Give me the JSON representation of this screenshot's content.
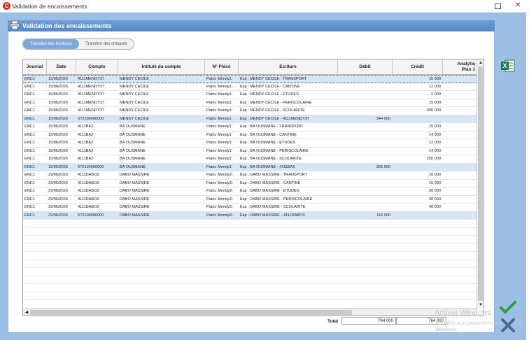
{
  "window": {
    "title": "Validation de encaissements",
    "maximize_glyph": "",
    "close_glyph": "✕"
  },
  "panel": {
    "title": "Validation des encaissements",
    "icon": "printer-icon"
  },
  "tabs": [
    {
      "label": "Transfert des écritures",
      "active": true
    },
    {
      "label": "Transfert des chèques",
      "active": false
    }
  ],
  "table": {
    "columns": [
      "Journal",
      "Date",
      "Compte",
      "Intitulé du compte",
      "N° Pièce",
      "Ecriture",
      "Débit",
      "Crédit",
      "Analytiq",
      "Plan 1"
    ],
    "rows": [
      {
        "journal": "ENC1",
        "date": "15/06/2026",
        "compte": "4111MENDY37",
        "intitule": "MENDY CECILE",
        "piece": "Patric Mendy1:",
        "ecriture": "Esp : MENDY CECILE - TRANSPORT",
        "debit": "",
        "credit": "15 000",
        "style": "sel"
      },
      {
        "journal": "ENC1",
        "date": "15/06/2026",
        "compte": "4111MENDY37",
        "intitule": "MENDY CECILE",
        "piece": "Patric Mendy1:",
        "ecriture": "Esp : MENDY CECILE - CANTINE",
        "debit": "",
        "credit": "12 000",
        "style": ""
      },
      {
        "journal": "ENC1",
        "date": "15/06/2026",
        "compte": "4111MENDY37",
        "intitule": "MENDY CECILE",
        "piece": "Patric Mendy1:",
        "ecriture": "Esp : MENDY CECILE - ETUDES",
        "debit": "",
        "credit": "2 000",
        "style": ""
      },
      {
        "journal": "ENC1",
        "date": "15/06/2026",
        "compte": "4111MENDY37",
        "intitule": "MENDY CECILE",
        "piece": "Patric Mendy1:",
        "ecriture": "Esp : MENDY CECILE - PERISCOLAIRE",
        "debit": "",
        "credit": "15 000",
        "style": ""
      },
      {
        "journal": "ENC1",
        "date": "15/06/2026",
        "compte": "4111MENDY37",
        "intitule": "MENDY CECILE",
        "piece": "Patric Mendy1:",
        "ecriture": "Esp : MENDY CECILE - SCOLARITE",
        "debit": "",
        "credit": "300 000",
        "style": ""
      },
      {
        "journal": "ENC1",
        "date": "15/06/2026",
        "compte": "572100000000",
        "intitule": "MENDY CECILE",
        "piece": "Patric Mendy1:",
        "ecriture": "Esp : MENDY CECILE - 4111MENDY37",
        "debit": "344 000",
        "credit": "",
        "style": "hl"
      },
      {
        "journal": "ENC1",
        "date": "15/06/2026",
        "compte": "4111BA2",
        "intitule": "BA OUSMANE",
        "piece": "Patric Mendy1'",
        "ecriture": "Esp : BA OUSMANE - TRANSPORT",
        "debit": "",
        "credit": "15 000",
        "style": ""
      },
      {
        "journal": "ENC1",
        "date": "15/06/2026",
        "compte": "4111BA2",
        "intitule": "BA OUSMANE",
        "piece": "Patric Mendy1'",
        "ecriture": "Esp : BA OUSMANE - CANTINE",
        "debit": "",
        "credit": "14 000",
        "style": ""
      },
      {
        "journal": "ENC1",
        "date": "15/06/2026",
        "compte": "4111BA2",
        "intitule": "BA OUSMANE",
        "piece": "Patric Mendy1'",
        "ecriture": "Esp : BA OUSMANE - ETUDES",
        "debit": "",
        "credit": "12 000",
        "style": ""
      },
      {
        "journal": "ENC1",
        "date": "15/06/2026",
        "compte": "4111BA2",
        "intitule": "BA OUSMANE",
        "piece": "Patric Mendy1'",
        "ecriture": "Esp : BA OUSMANE - PERISCOLAIRE",
        "debit": "",
        "credit": "14 000",
        "style": ""
      },
      {
        "journal": "ENC1",
        "date": "15/06/2026",
        "compte": "4111BA2",
        "intitule": "BA OUSMANE",
        "piece": "Patric Mendy1'",
        "ecriture": "Esp : BA OUSMANE - SCOLARITE",
        "debit": "",
        "credit": "250 000",
        "style": ""
      },
      {
        "journal": "ENC1",
        "date": "15/06/2026",
        "compte": "572100000000",
        "intitule": "BA OUSMANE",
        "piece": "Patric Mendy1'",
        "ecriture": "Esp : BA OUSMANE - 4111BA2",
        "debit": "305 000",
        "credit": "",
        "style": "hl"
      },
      {
        "journal": "ENC1",
        "date": "29/06/2026",
        "compte": "4111DABO3",
        "intitule": "DABO MASSIRE",
        "piece": "Patric Mendy2i",
        "ecriture": "Esp : DABO MASSIRE - TRANSPORT",
        "debit": "",
        "credit": "10 000",
        "style": ""
      },
      {
        "journal": "ENC1",
        "date": "29/06/2026",
        "compte": "4111DABO3",
        "intitule": "DABO MASSIRE",
        "piece": "Patric Mendy2i",
        "ecriture": "Esp : DABO MASSIRE - CANTINE",
        "debit": "",
        "credit": "15 000",
        "style": ""
      },
      {
        "journal": "ENC1",
        "date": "29/06/2026",
        "compte": "4111DABO3",
        "intitule": "DABO MASSIRE",
        "piece": "Patric Mendy2i",
        "ecriture": "Esp : DABO MASSIRE - ETUDES",
        "debit": "",
        "credit": "20 000",
        "style": ""
      },
      {
        "journal": "ENC1",
        "date": "29/06/2026",
        "compte": "4111DABO3",
        "intitule": "DABO MASSIRE",
        "piece": "Patric Mendy2i",
        "ecriture": "Esp : DABO MASSIRE - PERISCOLAIRE",
        "debit": "",
        "credit": "30 000",
        "style": ""
      },
      {
        "journal": "ENC1",
        "date": "29/06/2026",
        "compte": "4111DABO3",
        "intitule": "DABO MASSIRE",
        "piece": "Patric Mendy2i",
        "ecriture": "Esp : DABO MASSIRE - SCOLARITE",
        "debit": "",
        "credit": "40 000",
        "style": ""
      },
      {
        "journal": "ENC1",
        "date": "29/06/2026",
        "compte": "572100000000",
        "intitule": "DABO MASSIRE",
        "piece": "Patric Mendy2i",
        "ecriture": "Esp : DABO MASSIRE - 4111DABO3",
        "debit": "115 000",
        "credit": "",
        "style": "hl"
      }
    ]
  },
  "totals": {
    "label": "Total",
    "debit": "764 000",
    "credit": "764 000"
  },
  "actions": {
    "excel_icon": "excel-icon",
    "excel_letter": "X",
    "validate_icon": "checkmark-icon",
    "cancel_icon": "cross-icon"
  },
  "watermark": {
    "line1": "Activer Windows",
    "line2": "Accédez aux paramètres pour activer Windows."
  },
  "colors": {
    "frame": "#9dbfe6",
    "header": "#5589c9",
    "highlight": "#d6e6f7",
    "accept": "#2e9e3b",
    "cancel": "#4a6a8a"
  }
}
